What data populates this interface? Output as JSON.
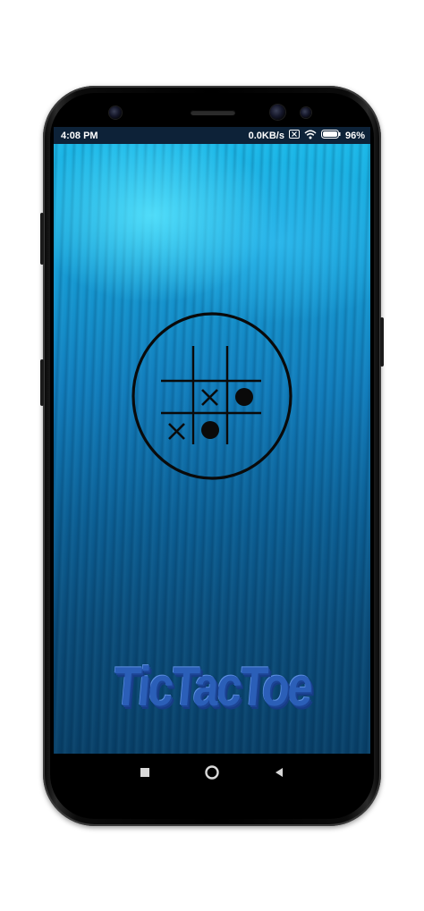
{
  "status_bar": {
    "time": "4:08 PM",
    "network_speed": "0.0KB/s",
    "battery": "96%",
    "icons": [
      "sim-x-icon",
      "wifi-icon",
      "battery-icon"
    ]
  },
  "app": {
    "title": "TicTacToe",
    "logo": "tictactoe-logo",
    "title_color": "#2b5fb8"
  },
  "nav_bar": {
    "buttons": [
      "recent-apps-icon",
      "home-icon",
      "back-icon"
    ]
  },
  "colors": {
    "status_bar_bg": "#0d2238",
    "wallpaper_top": "#1bb8e8",
    "wallpaper_bottom": "#083e66"
  }
}
